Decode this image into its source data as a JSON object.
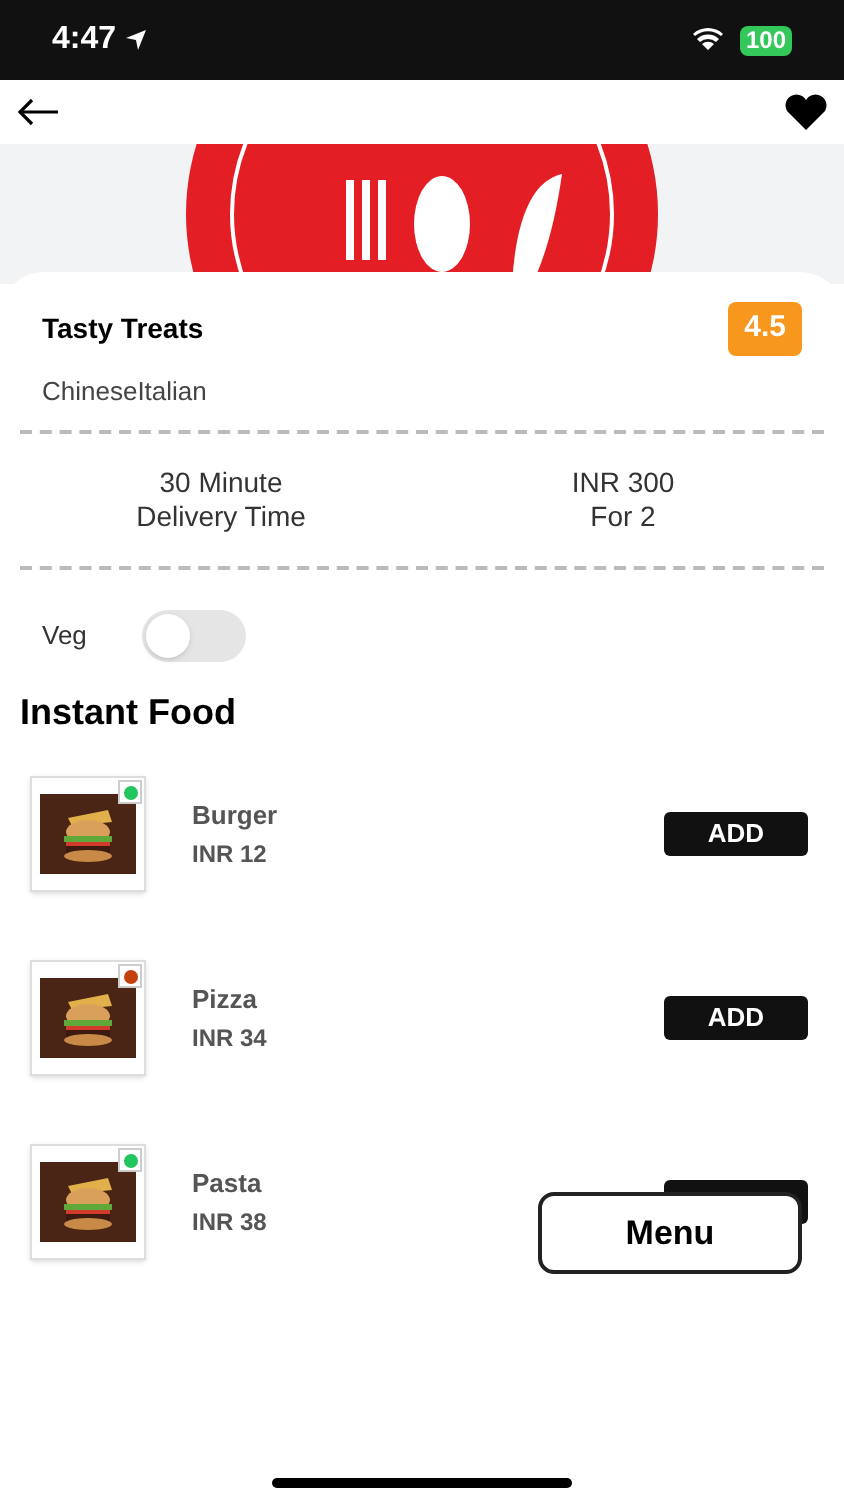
{
  "status_bar": {
    "time": "4:47",
    "battery": "100"
  },
  "restaurant": {
    "name": "Tasty Treats",
    "rating": "4.5",
    "cuisines": "ChineseItalian"
  },
  "stats": [
    {
      "value": "30 Minute",
      "label": "Delivery Time"
    },
    {
      "value": "INR 300",
      "label": "For 2"
    }
  ],
  "veg_filter": {
    "label": "Veg",
    "on": false
  },
  "section_title": "Instant Food",
  "items": [
    {
      "name": "Burger",
      "price": "INR 12",
      "color": "#22c55e",
      "button": "ADD",
      "kind": "picture"
    },
    {
      "name": "Pizza",
      "price": "INR 34",
      "color": "#c2410c",
      "button": "ADD",
      "kind": "picture"
    },
    {
      "name": "Pasta",
      "price": "INR 38",
      "color": "#22c55e",
      "kind": "picture"
    }
  ],
  "menu_button": "Menu"
}
